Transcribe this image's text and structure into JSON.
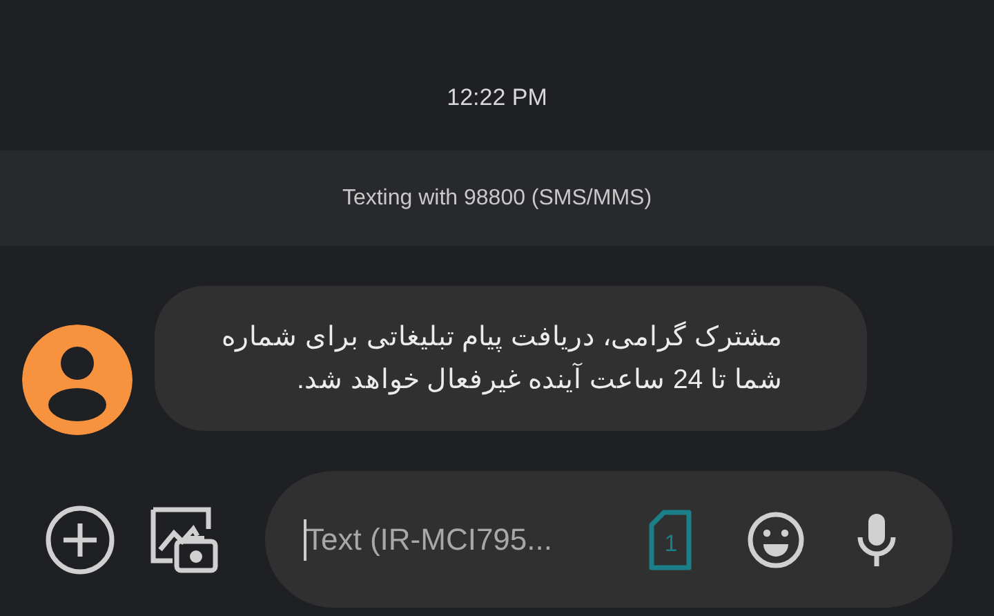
{
  "timestamp": "12:22 PM",
  "conversation_banner": "Texting with 98800 (SMS/MMS)",
  "message": {
    "text": "مشترک گرامی، دریافت پیام تبلیغاتی برای شماره شما تا 24 ساعت آینده غیرفعال خواهد شد."
  },
  "compose": {
    "placeholder": "Text (IR-MCI795...",
    "sim_number": "1"
  }
}
